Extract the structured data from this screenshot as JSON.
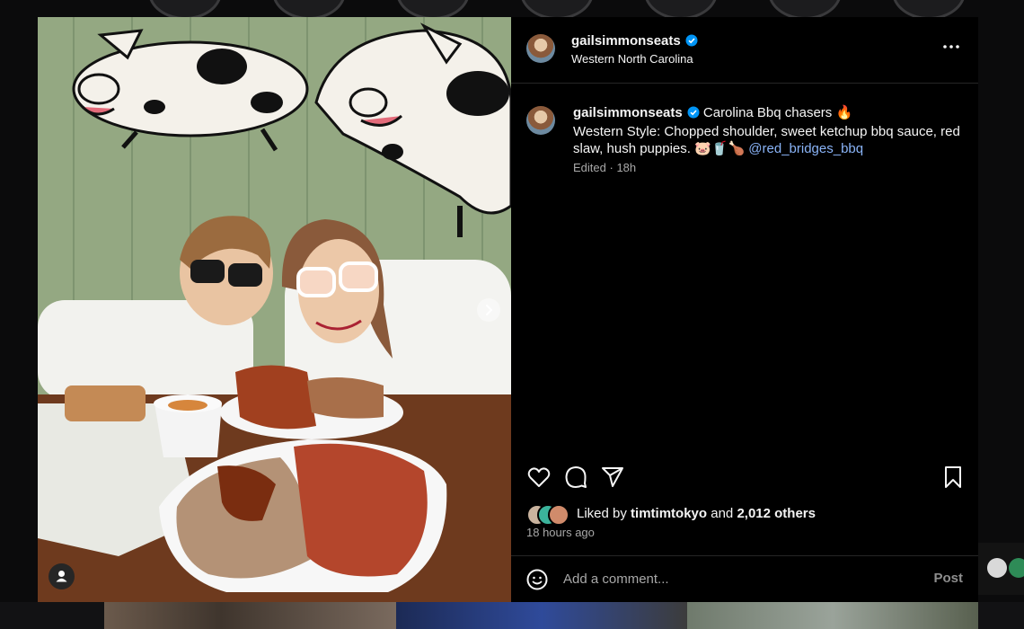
{
  "post": {
    "username": "gailsimmonseats",
    "location": "Western North Carolina",
    "caption_line1": "Carolina Bbq chasers 🔥",
    "caption_line2": "Western Style: Chopped shoulder, sweet ketchup bbq sauce, red slaw, hush puppies. 🐷🥤🍗",
    "mention": "@red_bridges_bbq",
    "edited": "Edited",
    "age_short": "18h"
  },
  "likes": {
    "prefix": "Liked by",
    "user": "timtimtokyo",
    "and": "and",
    "others": "2,012 others"
  },
  "posted": "18 hours ago",
  "comment": {
    "placeholder": "Add a comment...",
    "post_label": "Post"
  },
  "icons": {
    "verified": "verified-badge-icon",
    "more": "more-options-icon",
    "like": "heart-icon",
    "comment": "comment-bubble-icon",
    "share": "send-paper-plane-icon",
    "save": "bookmark-icon",
    "emoji": "emoji-smiley-icon",
    "next": "chevron-right-icon",
    "tag": "person-tag-icon"
  },
  "colors": {
    "background": "#000000",
    "verified": "#0095f6",
    "mention": "#8ab4f8",
    "secondary_text": "#a8a8a8"
  }
}
